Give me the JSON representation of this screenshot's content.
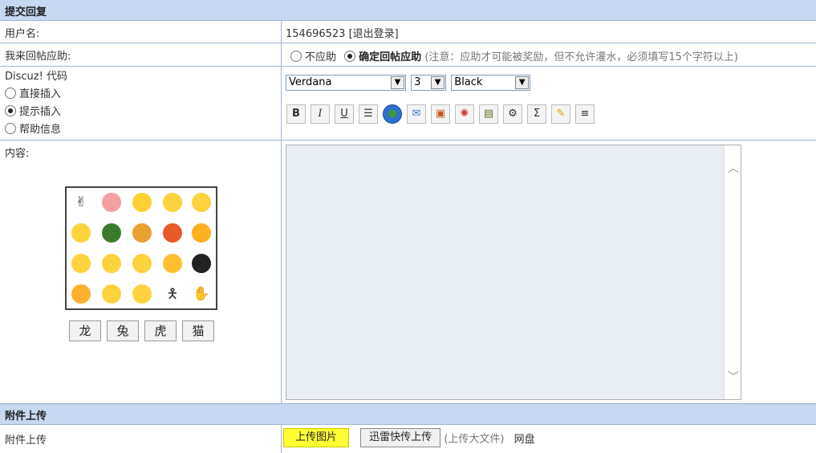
{
  "reply_header": "提交回复",
  "username": {
    "label": "用户名:",
    "value": "154696523",
    "logout": "[退出登录]"
  },
  "help_reply": {
    "label": "我来回帖应助:",
    "option_no": "不应助",
    "option_yes": "确定回帖应助",
    "note": "(注意：应助才可能被奖励，但不允许灌水，必须填写15个字符以上)"
  },
  "discuz": {
    "label": "Discuz! 代码",
    "options": [
      "直接插入",
      "提示插入",
      "帮助信息"
    ],
    "selected": "提示插入"
  },
  "editor": {
    "font": "Verdana",
    "size": "3",
    "color": "Black",
    "tools": [
      "bold-icon",
      "italic-icon",
      "underline-icon",
      "center-icon",
      "globe-icon",
      "email-icon",
      "image-icon",
      "media-icon",
      "film-icon",
      "code-icon",
      "quote-icon",
      "pin-icon",
      "list-icon"
    ]
  },
  "content": {
    "label": "内容:",
    "emoticon_tabs": [
      "龙",
      "兔",
      "虎",
      "猫"
    ]
  },
  "attach_header": "附件上传",
  "attach": {
    "label": "附件上传",
    "upload_image": "上传图片",
    "fast_upload": "迅雷快传上传",
    "big_file": "(上传大文件)",
    "netdisk": "网盘"
  }
}
